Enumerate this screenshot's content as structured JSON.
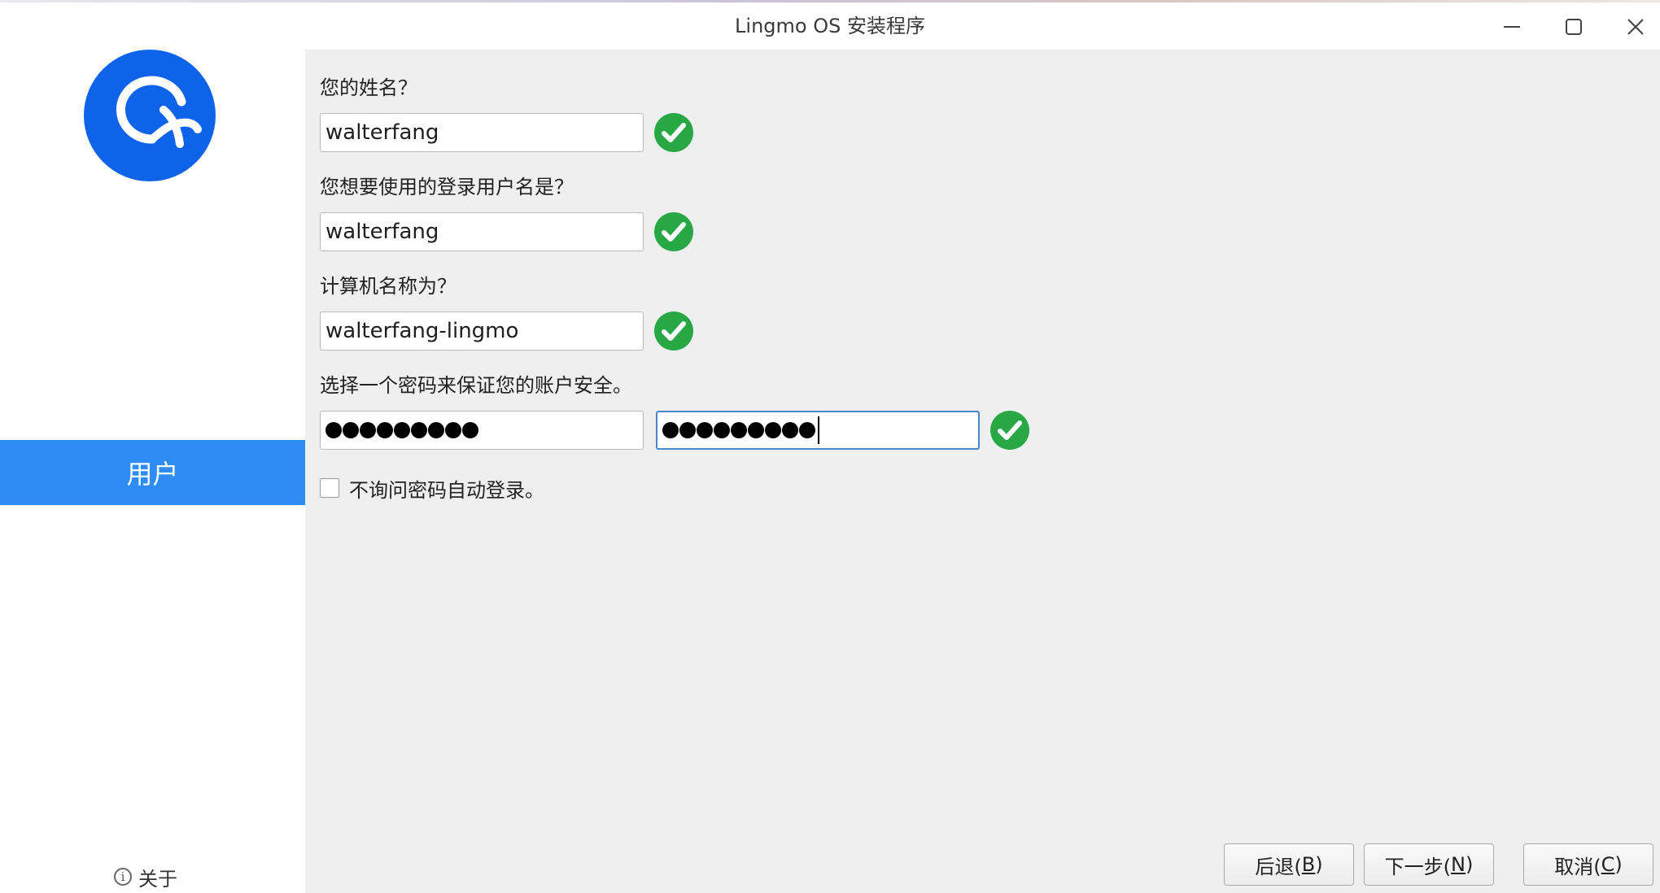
{
  "window": {
    "title": "Lingmo OS 安装程序"
  },
  "sidebar": {
    "active_item": "用户",
    "about_label": "关于",
    "about_icon": "info-circle-icon"
  },
  "form": {
    "name_label": "您的姓名？",
    "name_value": "walterfang",
    "username_label": "您想要使用的登录用户名是？",
    "username_value": "walterfang",
    "hostname_label": "计算机名称为？",
    "hostname_value": "walterfang-lingmo",
    "password_label": "选择一个密码来保证您的账户安全。",
    "password_length": 9,
    "password_confirm_length": 9,
    "autologin_label": "不询问密码自动登录。",
    "autologin_checked": false
  },
  "buttons": {
    "back_label": "后退(",
    "back_key": "B",
    "next_label": "下一步(",
    "next_key": "N",
    "cancel_label": "取消(",
    "cancel_key": "C",
    "close_paren": ")"
  },
  "colors": {
    "accent": "#2f8bf6",
    "check_green": "#27a844",
    "logo_blue": "#0e63ea"
  }
}
